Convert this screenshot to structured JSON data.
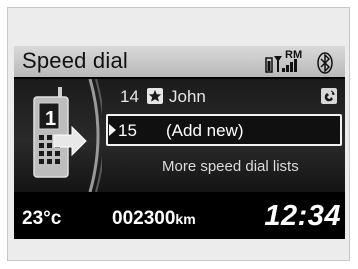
{
  "header": {
    "title": "Speed dial",
    "status_icons": [
      "phone-battery-icon",
      "signal-strength-icon",
      "roaming-icon",
      "bluetooth-icon"
    ],
    "roaming_label": "RM"
  },
  "left_panel": {
    "icon": "phone-speed-dial-icon",
    "speed_dial_number": "1"
  },
  "list": {
    "items": [
      {
        "number": "14",
        "name": "John",
        "has_star": true,
        "has_voice_tag": true
      },
      {
        "number": "15",
        "name": "(Add new)",
        "selected": true
      }
    ],
    "more_label": "More speed dial lists"
  },
  "footer": {
    "temperature": "23°c",
    "odometer_value": "002300",
    "odometer_unit": "km",
    "clock": "12:34"
  },
  "colors": {
    "screen_bg": "#000000",
    "header_bg": "#c8c8c8",
    "text": "#ffffff"
  }
}
